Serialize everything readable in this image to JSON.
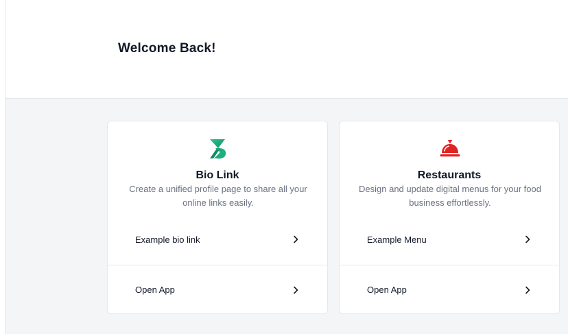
{
  "header": {
    "title": "Welcome Back!"
  },
  "cards": [
    {
      "icon": "bio-link-logo-icon",
      "title": "Bio Link",
      "description": "Create a unified profile page to share all your online links easily.",
      "links": [
        {
          "label": "Example bio link",
          "icon": "chevron-right-icon"
        },
        {
          "label": "Open App",
          "icon": "chevron-right-icon"
        }
      ]
    },
    {
      "icon": "service-bell-icon",
      "title": "Restaurants",
      "description": "Design and update digital menus for your food business effortlessly.",
      "links": [
        {
          "label": "Example Menu",
          "icon": "chevron-right-icon"
        },
        {
          "label": "Open App",
          "icon": "chevron-right-icon"
        }
      ]
    }
  ],
  "colors": {
    "bio_accent": "#1fae7e",
    "restaurant_accent": "#e02424",
    "background": "#f4f5f7",
    "border": "#e5e7eb"
  }
}
